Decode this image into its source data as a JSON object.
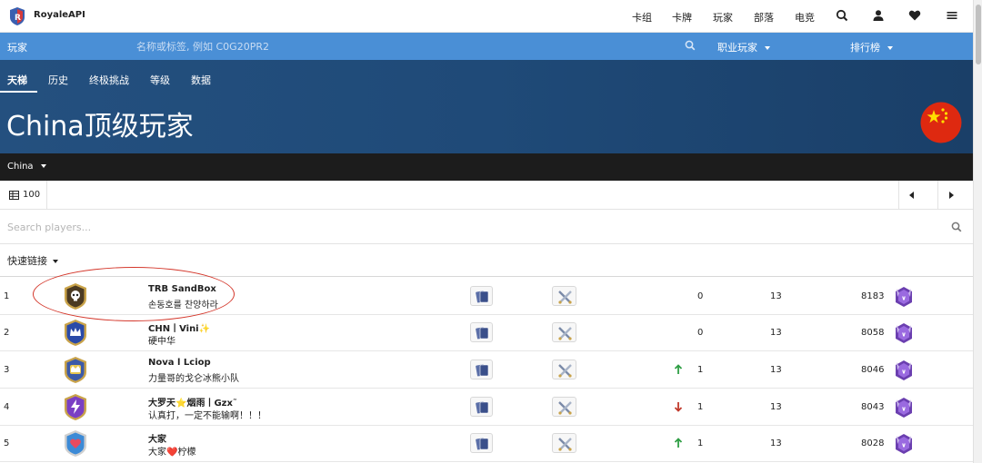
{
  "brand": "RoyaleAPI",
  "nav": [
    "卡组",
    "卡牌",
    "玩家",
    "部落",
    "电竞"
  ],
  "searchbar": {
    "label": "玩家",
    "placeholder": "名称或标签, 例如 C0G20PR2",
    "pro_players": "职业玩家",
    "rankings": "排行榜"
  },
  "tabs": [
    "天梯",
    "历史",
    "终极挑战",
    "等级",
    "数据"
  ],
  "hero_title": "China顶级玩家",
  "region": "China",
  "page_size": "100",
  "player_search_placeholder": "Search players...",
  "quick_links": "快速链接",
  "rows": [
    {
      "rank": "1",
      "name": "TRB SandBox",
      "clan": "손동호를 찬양하라",
      "change": "0",
      "level": "13",
      "trophies": "8183",
      "trend": "none"
    },
    {
      "rank": "2",
      "name": "CHN丨Vini✨",
      "clan": "硬中华",
      "change": "0",
      "level": "13",
      "trophies": "8058",
      "trend": "none"
    },
    {
      "rank": "3",
      "name": "Nova l Lciop",
      "clan": "力量哥的戈仑冰熊小队",
      "change": "1",
      "level": "13",
      "trophies": "8046",
      "trend": "up"
    },
    {
      "rank": "4",
      "name": "大罗天⭐烟雨丨Gzx˜",
      "clan": "认真打，一定不能输啊！！！",
      "change": "1",
      "level": "13",
      "trophies": "8043",
      "trend": "down"
    },
    {
      "rank": "5",
      "name": "大家",
      "clan": "大家❤️柠檬",
      "change": "1",
      "level": "13",
      "trophies": "8028",
      "trend": "up"
    }
  ],
  "colors": {
    "accent": "#4a8fd6",
    "hero": "#24507f",
    "up": "#2e9e44",
    "down": "#c0392b",
    "highlight": "#d4372b"
  }
}
